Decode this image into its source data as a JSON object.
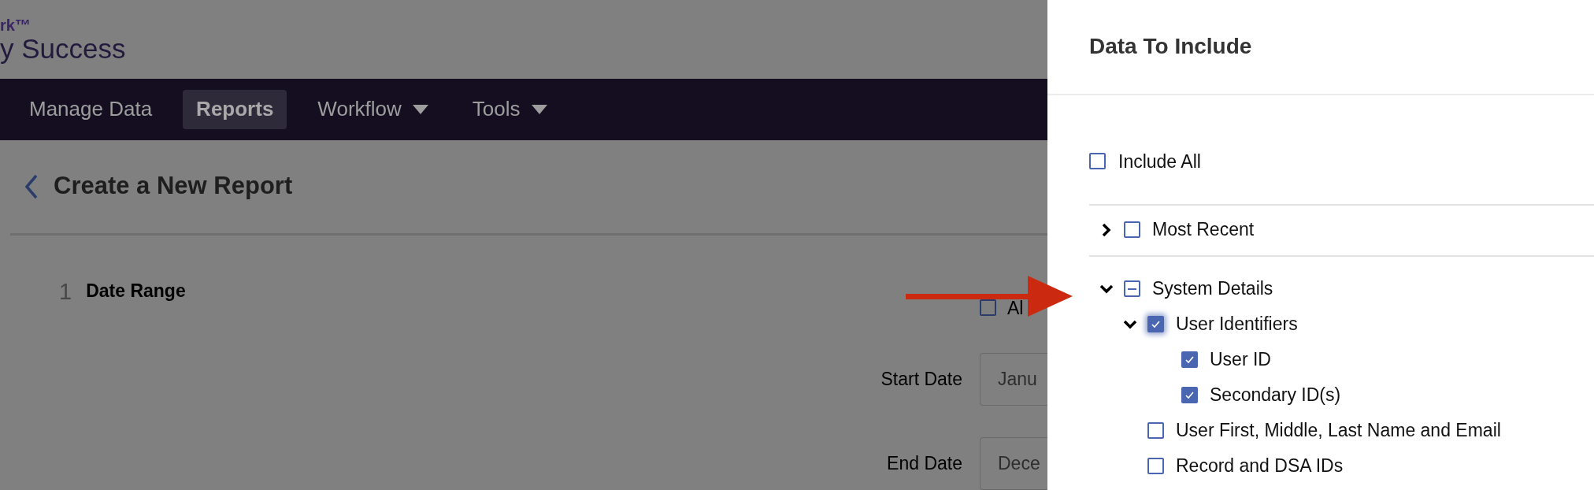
{
  "brand": {
    "mark": "rk™",
    "name": "y Success"
  },
  "nav": [
    {
      "label": "Manage Data",
      "selected": false,
      "dropdown": false
    },
    {
      "label": "Reports",
      "selected": true,
      "dropdown": false
    },
    {
      "label": "Workflow",
      "selected": false,
      "dropdown": true
    },
    {
      "label": "Tools",
      "selected": false,
      "dropdown": true
    }
  ],
  "page_title": "Create a New Report",
  "step": {
    "number": "1",
    "title": "Date Range",
    "all_dates": {
      "label": "Al",
      "checked": false
    },
    "fields": [
      {
        "label": "Start Date",
        "value": "Janu"
      },
      {
        "label": "End Date",
        "value": "Dece"
      }
    ]
  },
  "panel": {
    "title": "Data To Include",
    "include_all": {
      "label": "Include All",
      "checked": false
    },
    "tree": [
      {
        "label": "Most Recent",
        "checked": false,
        "expanded": false
      },
      {
        "label": "System Details",
        "checked": false,
        "partial": true,
        "expanded": true,
        "children": [
          {
            "label": "User Identifiers",
            "checked": true,
            "expanded": true,
            "focused": true,
            "children": [
              {
                "label": "User ID",
                "checked": true
              },
              {
                "label": "Secondary ID(s)",
                "checked": true
              }
            ]
          },
          {
            "label": "User First, Middle, Last Name and Email",
            "checked": false
          },
          {
            "label": "Record and DSA IDs",
            "checked": false
          }
        ]
      }
    ]
  }
}
